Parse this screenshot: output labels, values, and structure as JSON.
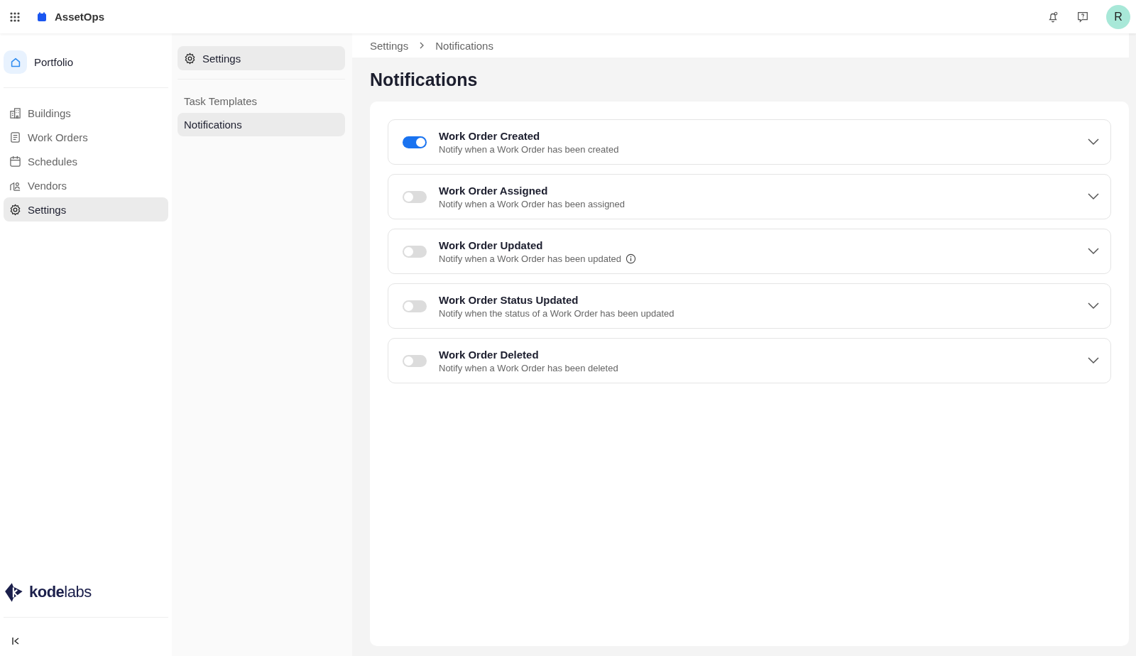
{
  "app": {
    "name": "AssetOps",
    "avatar": "R"
  },
  "sidebar": {
    "home": "Portfolio",
    "items": [
      {
        "label": "Buildings",
        "kind": "building",
        "selected": false
      },
      {
        "label": "Work Orders",
        "kind": "document",
        "selected": false
      },
      {
        "label": "Schedules",
        "kind": "calendar",
        "selected": false
      },
      {
        "label": "Vendors",
        "kind": "vendor",
        "selected": false
      },
      {
        "label": "Settings",
        "kind": "gear",
        "selected": true
      }
    ],
    "logo": "**kode**labs"
  },
  "subnav": {
    "header": "Settings",
    "items": [
      {
        "label": "Task Templates",
        "selected": false
      },
      {
        "label": "Notifications",
        "selected": true
      }
    ]
  },
  "breadcrumb": [
    "Settings",
    "Notifications"
  ],
  "page_title": "Notifications",
  "notifications": [
    {
      "title": "Work Order Created",
      "description": "Notify when a Work Order has been created",
      "on": true,
      "info": false
    },
    {
      "title": "Work Order Assigned",
      "description": "Notify when a Work Order has been assigned",
      "on": false,
      "info": false
    },
    {
      "title": "Work Order Updated",
      "description": "Notify when a Work Order has been updated",
      "on": false,
      "info": true
    },
    {
      "title": "Work Order Status Updated",
      "description": "Notify when the status of a Work Order has been updated",
      "on": false,
      "info": false
    },
    {
      "title": "Work Order Deleted",
      "description": "Notify when a Work Order has been deleted",
      "on": false,
      "info": false
    }
  ]
}
